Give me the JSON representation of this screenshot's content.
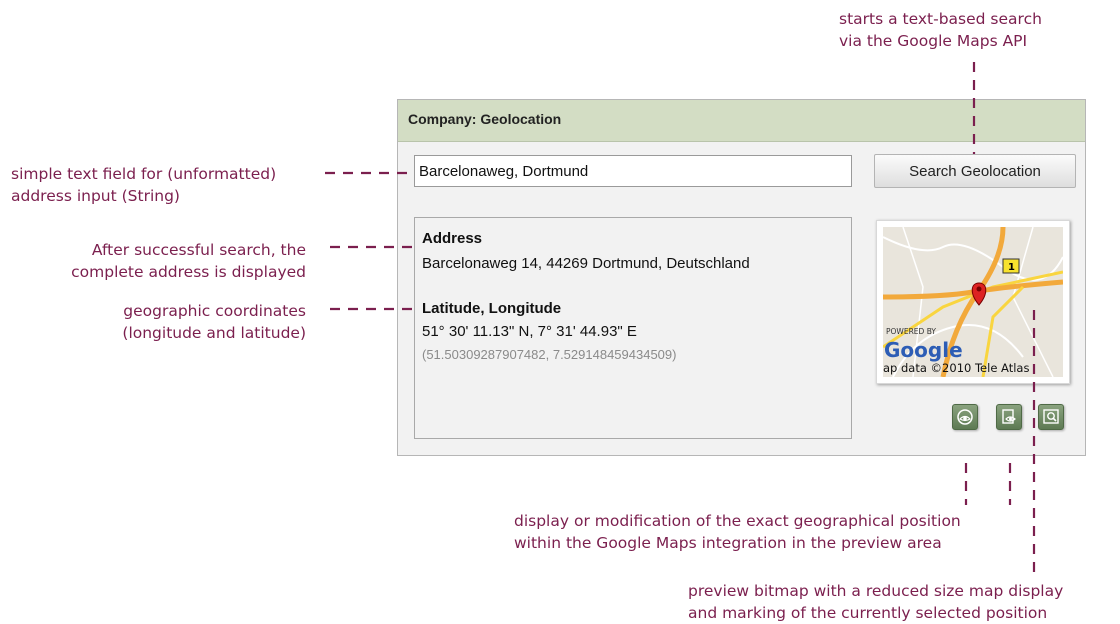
{
  "panel": {
    "title": "Company: Geolocation",
    "address_input_value": "Barcelonaweg, Dortmund",
    "search_button_label": "Search Geolocation",
    "address_heading": "Address",
    "address_value": "Barcelonaweg 14, 44269 Dortmund, Deutschland",
    "coords_heading": "Latitude, Longitude",
    "coords_dms": "51° 30' 11.13\" N, 7° 31' 44.93\" E",
    "coords_decimal": "(51.50309287907482, 7.529148459434509)",
    "map": {
      "powered_by": "POWERED BY",
      "logo_text": "Google",
      "attribution": "ap data ©2010 Tele Atlas",
      "road_number": "1"
    },
    "icon_buttons": [
      "view-position-icon",
      "edit-position-icon",
      "preview-zoom-icon"
    ]
  },
  "annotations": {
    "search_button_note": [
      "starts a text-based search",
      "via the Google Maps API"
    ],
    "text_field_note": [
      "simple text field for (unformatted)",
      "address input (String)"
    ],
    "address_note": [
      "After successful search, the",
      "complete address is displayed"
    ],
    "coords_note": [
      "geographic coordinates",
      "(longitude and latitude)"
    ],
    "position_note": [
      "display or modification of the exact geographical position",
      "within the Google Maps integration in the preview area"
    ],
    "preview_note": [
      "preview bitmap with a reduced size map display",
      "and marking of the currently selected position"
    ]
  },
  "colors": {
    "annotation": "#7b1f4e",
    "header_bg": "#d3ddc4",
    "icon_button": "#6f8c65"
  }
}
